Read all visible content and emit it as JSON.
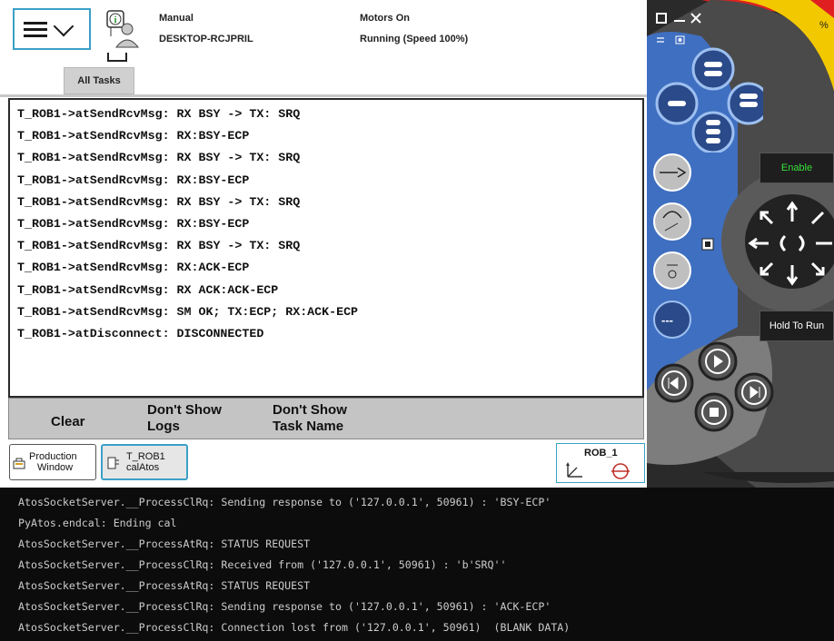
{
  "status": {
    "mode": "Manual",
    "host": "DESKTOP-RCJPRIL",
    "motors": "Motors On",
    "running": "Running (Speed 100%)"
  },
  "tabs": {
    "all_tasks": "All Tasks"
  },
  "log_lines": [
    "T_ROB1->atSendRcvMsg: RX BSY -> TX: SRQ",
    "T_ROB1->atSendRcvMsg: RX:BSY-ECP",
    "T_ROB1->atSendRcvMsg: RX BSY -> TX: SRQ",
    "T_ROB1->atSendRcvMsg: RX:BSY-ECP",
    "T_ROB1->atSendRcvMsg: RX BSY -> TX: SRQ",
    "T_ROB1->atSendRcvMsg: RX:BSY-ECP",
    "T_ROB1->atSendRcvMsg: RX BSY -> TX: SRQ",
    "T_ROB1->atSendRcvMsg: RX:ACK-ECP",
    "T_ROB1->atSendRcvMsg: RX ACK:ACK-ECP",
    "T_ROB1->atSendRcvMsg: SM OK; TX:ECP; RX:ACK-ECP",
    "T_ROB1->atDisconnect: DISCONNECTED"
  ],
  "buttons": {
    "clear": "Clear",
    "dont_show_logs_1": "Don't Show",
    "dont_show_logs_2": "Logs",
    "dont_show_task_1": "Don't Show",
    "dont_show_task_2": "Task Name"
  },
  "taskbar": {
    "production_1": "Production",
    "production_2": "Window",
    "trob_1": "T_ROB1",
    "trob_2": "calAtos",
    "rob": "ROB_1"
  },
  "controls": {
    "enable": "Enable",
    "hold_to_run": "Hold To Run",
    "percent": "%",
    "minus": "---"
  },
  "terminal_lines": [
    "AtosSocketServer.__ProcessClRq: Sending response to ('127.0.0.1', 50961) : 'BSY-ECP'",
    "PyAtos.endcal: Ending cal",
    "AtosSocketServer.__ProcessAtRq: STATUS REQUEST",
    "AtosSocketServer.__ProcessClRq: Received from ('127.0.0.1', 50961) : 'b'SRQ''",
    "AtosSocketServer.__ProcessAtRq: STATUS REQUEST",
    "AtosSocketServer.__ProcessClRq: Sending response to ('127.0.0.1', 50961) : 'ACK-ECP'",
    "AtosSocketServer.__ProcessClRq: Connection lost from ('127.0.0.1', 50961)  (BLANK DATA)"
  ],
  "colors": {
    "accent": "#3aa0c8",
    "joystick_blue": "#3f6fc0",
    "enable_green": "#38e038",
    "yellow": "#f2c800",
    "red": "#d42020"
  }
}
